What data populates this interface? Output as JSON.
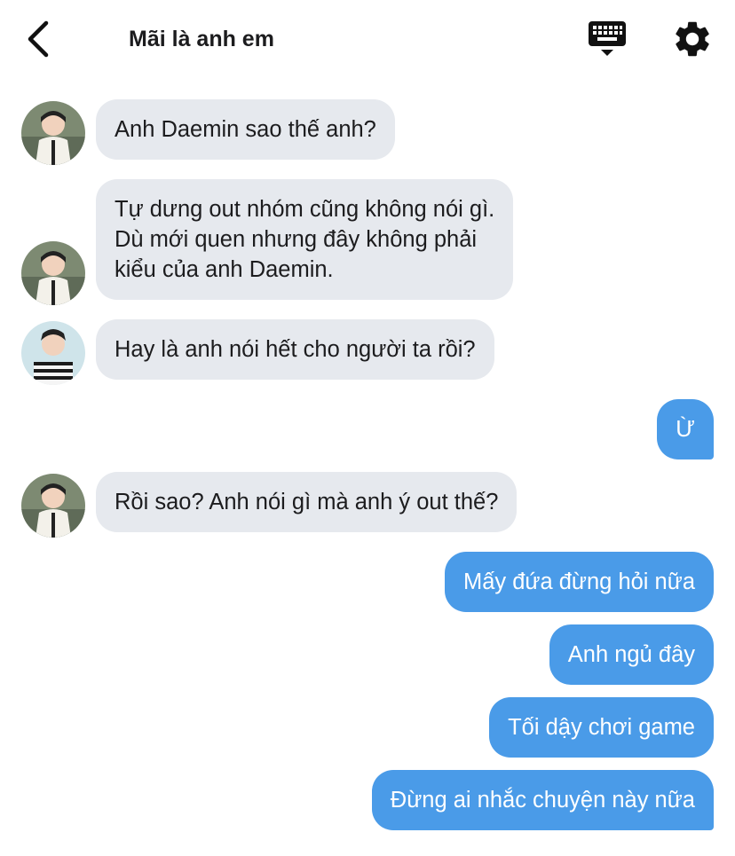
{
  "header": {
    "title": "Mãi là anh em"
  },
  "messages": {
    "m1": "Anh Daemin sao thế anh?",
    "m2": "Tự dưng out nhóm cũng không nói gì.\nDù mới quen nhưng đây không phải\nkiểu của anh Daemin.",
    "m3": "Hay là anh nói hết cho người ta rồi?",
    "m4": "Ừ",
    "m5": "Rồi sao? Anh nói gì mà anh ý out thế?",
    "m6": "Mấy đứa đừng hỏi nữa",
    "m7": "Anh ngủ đây",
    "m8": "Tối dậy chơi game",
    "m9": "Đừng ai nhắc chuyện này nữa"
  },
  "colors": {
    "incoming_bubble": "#e6e9ee",
    "outgoing_bubble": "#4a9be8",
    "text": "#1c1c1e"
  },
  "icons": {
    "back": "back-chevron-icon",
    "keyboard": "keyboard-icon",
    "settings": "gear-icon"
  }
}
